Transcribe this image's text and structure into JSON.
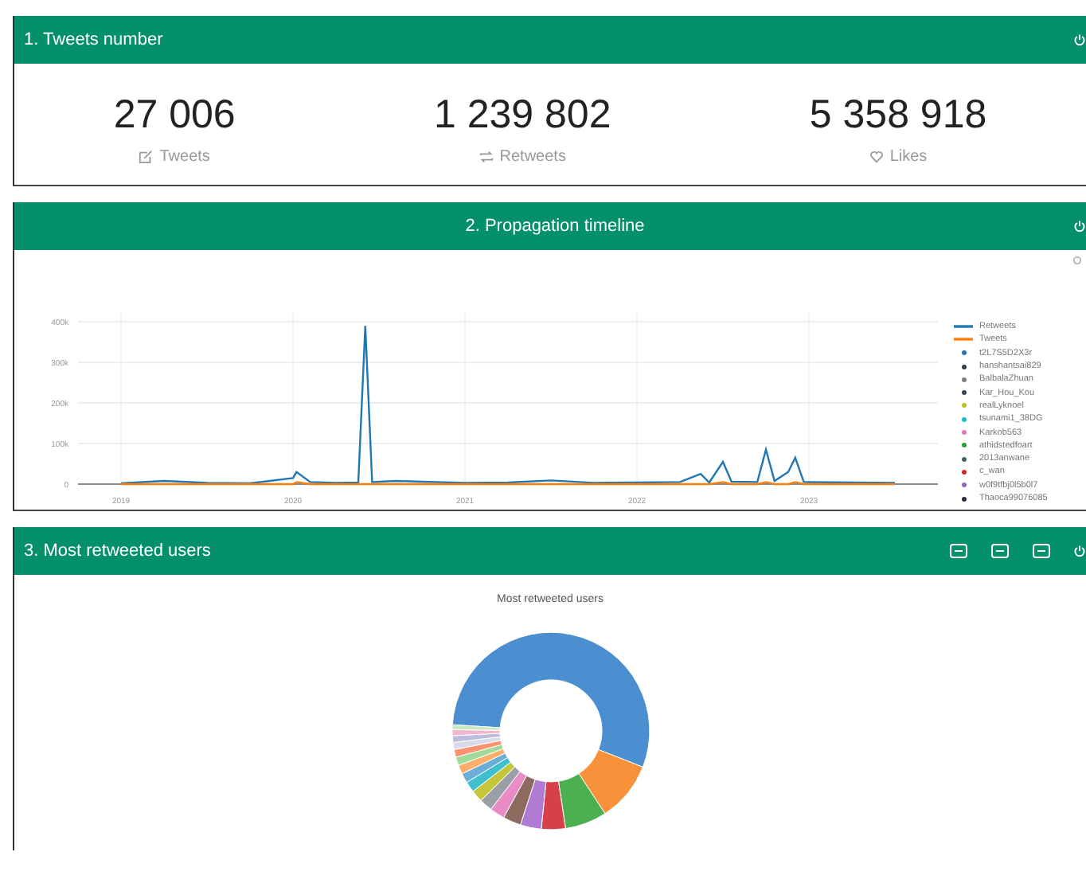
{
  "panels": [
    {
      "title": "1. Tweets number",
      "stats": [
        {
          "value": "27 006",
          "label": "Tweets",
          "kind": "edit"
        },
        {
          "value": "1 239 802",
          "label": "Retweets",
          "kind": "retweet"
        },
        {
          "value": "5 358 918",
          "label": "Likes",
          "kind": "heart"
        }
      ]
    },
    {
      "title": "2. Propagation timeline",
      "chart_data": {
        "type": "line",
        "x": [
          2019.0,
          2019.25,
          2019.5,
          2019.75,
          2020.0,
          2020.02,
          2020.1,
          2020.25,
          2020.38,
          2020.42,
          2020.46,
          2020.6,
          2020.75,
          2021.0,
          2021.25,
          2021.5,
          2021.75,
          2022.0,
          2022.25,
          2022.37,
          2022.42,
          2022.5,
          2022.55,
          2022.7,
          2022.75,
          2022.8,
          2022.88,
          2022.92,
          2022.97,
          2023.25,
          2023.5
        ],
        "series": [
          {
            "name": "Retweets",
            "color": "#1f77b4",
            "values": [
              2000,
              8000,
              3000,
              2000,
              15000,
              30000,
              5000,
              3000,
              4000,
              390000,
              5000,
              8000,
              6000,
              3000,
              4000,
              9000,
              3000,
              4000,
              5000,
              25000,
              4000,
              55000,
              6000,
              5000,
              85000,
              8000,
              30000,
              65000,
              5000,
              4000,
              3000
            ]
          },
          {
            "name": "Tweets",
            "color": "#ff7f0e",
            "values": [
              0,
              0,
              0,
              0,
              0,
              5000,
              0,
              0,
              0,
              0,
              0,
              0,
              0,
              0,
              0,
              0,
              0,
              0,
              0,
              0,
              0,
              5000,
              0,
              0,
              5000,
              0,
              0,
              5000,
              0,
              0,
              0
            ]
          }
        ],
        "grid": true,
        "xlim": [
          2018.75,
          2023.75
        ],
        "ylim": [
          0,
          420000
        ],
        "xticks": [
          2019,
          2020,
          2021,
          2022,
          2023
        ],
        "yticks": [
          {
            "value": 0,
            "label": "0"
          },
          {
            "value": 100000,
            "label": "100k"
          },
          {
            "value": 200000,
            "label": "200k"
          },
          {
            "value": 300000,
            "label": "300k"
          },
          {
            "value": 400000,
            "label": "400k"
          }
        ]
      },
      "legend_users": [
        {
          "name": "t2L7S5D2X3r",
          "color": "#1f77b4"
        },
        {
          "name": "hanshantsai829",
          "color": "#2d3e50"
        },
        {
          "name": "BalbalaZhuan",
          "color": "#7f7f7f"
        },
        {
          "name": "Kar_Hou_Kou",
          "color": "#34495e"
        },
        {
          "name": "realLyknoel",
          "color": "#bcbd22"
        },
        {
          "name": "tsunami1_38DG",
          "color": "#17becf"
        },
        {
          "name": "Karkob563",
          "color": "#e377c2"
        },
        {
          "name": "athidstedfoart",
          "color": "#2ca02c"
        },
        {
          "name": "2013anwane",
          "color": "#3d6b5a"
        },
        {
          "name": "c_wan",
          "color": "#d62728"
        },
        {
          "name": "w0f9tfbj0l5b0l7",
          "color": "#9467bd"
        },
        {
          "name": "Thaoca99076085",
          "color": "#2b2b4b"
        }
      ]
    },
    {
      "title": "3. Most retweeted users",
      "chart_title": "Most retweeted users",
      "tools": [
        {
          "kind": "table"
        },
        {
          "kind": "table"
        },
        {
          "kind": "table"
        }
      ]
    }
  ]
}
